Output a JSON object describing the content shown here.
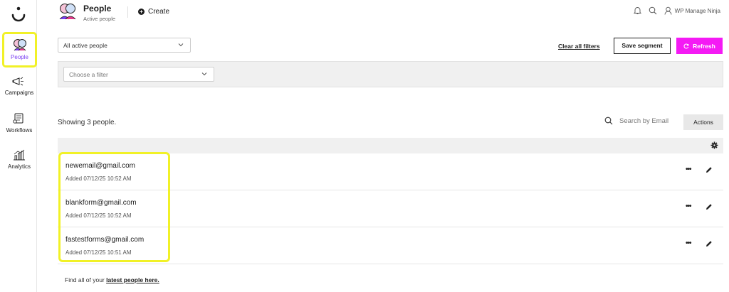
{
  "sidebar": {
    "items": [
      {
        "label": "People",
        "icon": "people-icon",
        "active": true
      },
      {
        "label": "Campaigns",
        "icon": "megaphone-icon"
      },
      {
        "label": "Workflows",
        "icon": "workflow-icon"
      },
      {
        "label": "Analytics",
        "icon": "analytics-icon"
      }
    ]
  },
  "header": {
    "title": "People",
    "subtitle": "Active people",
    "create_label": "Create",
    "user_name": "WP Manage Ninja"
  },
  "toolbar": {
    "segment_value": "All active people",
    "clear_filters_label": "Clear all filters",
    "save_segment_label": "Save segment",
    "refresh_label": "Refresh"
  },
  "filter": {
    "placeholder": "Choose a filter"
  },
  "list": {
    "showing_text": "Showing 3 people.",
    "search_placeholder": "Search by Email",
    "actions_label": "Actions",
    "rows": [
      {
        "email": "newemail@gmail.com",
        "added": "Added 07/12/25 10:52 AM"
      },
      {
        "email": "blankform@gmail.com",
        "added": "Added 07/12/25 10:52 AM"
      },
      {
        "email": "fastestforms@gmail.com",
        "added": "Added 07/12/25 10:51 AM"
      }
    ],
    "more_label": "•••"
  },
  "footer": {
    "text": "Find all of your",
    "link_label": "latest people here."
  },
  "colors": {
    "accent": "#f41af4",
    "active_nav": "#7a3ff2",
    "highlight": "#f1f127"
  }
}
